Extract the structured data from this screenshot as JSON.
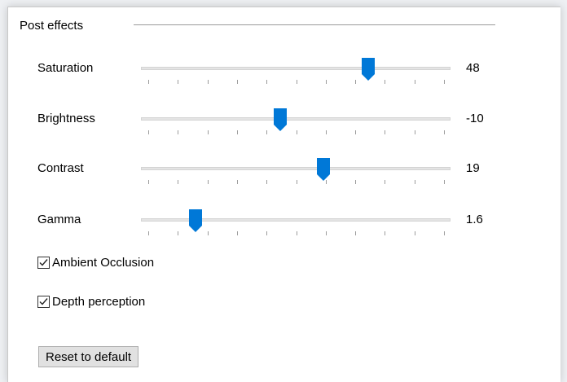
{
  "group": {
    "title": "Post effects"
  },
  "sliders": [
    {
      "label": "Saturation",
      "value_text": "48",
      "fraction": 0.733
    },
    {
      "label": "Brightness",
      "value_text": "-10",
      "fraction": 0.45
    },
    {
      "label": "Contrast",
      "value_text": "19",
      "fraction": 0.59
    },
    {
      "label": "Gamma",
      "value_text": "1.6",
      "fraction": 0.175
    }
  ],
  "checkboxes": [
    {
      "label": "Ambient Occlusion",
      "checked": true
    },
    {
      "label": "Depth perception",
      "checked": true
    }
  ],
  "buttons": {
    "reset_label": "Reset to default"
  },
  "colors": {
    "thumb": "#0078d7",
    "track": "#e4e4e4"
  }
}
